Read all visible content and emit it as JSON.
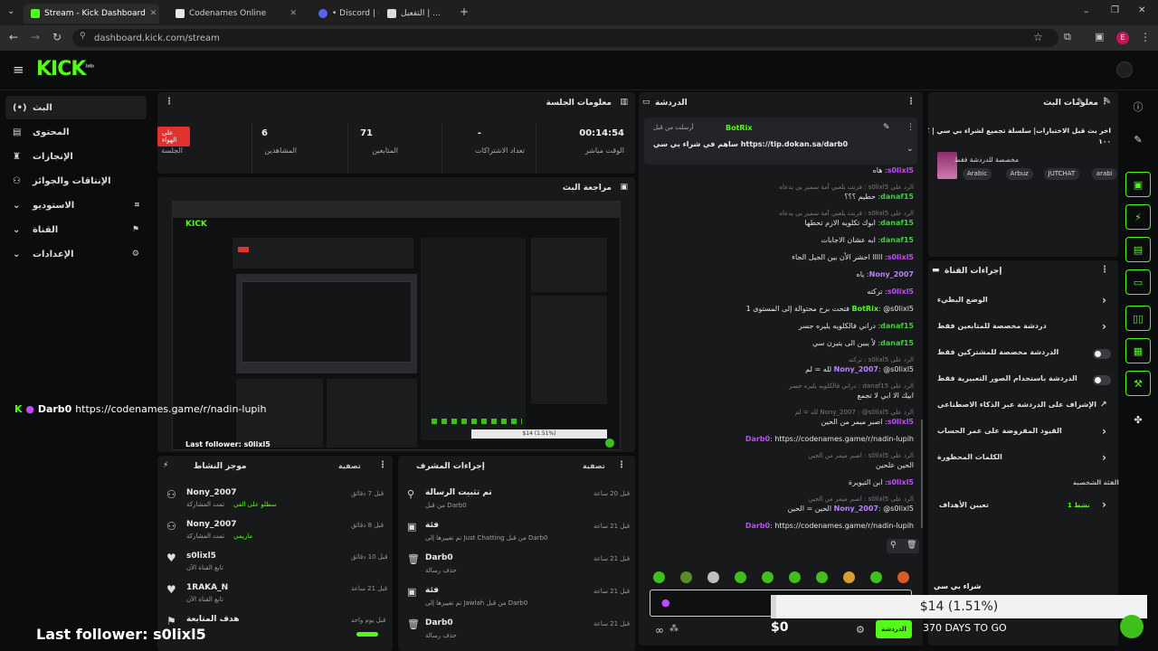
{
  "browser": {
    "tabs": [
      {
        "label": "Stream - Kick Dashboard",
        "active": true,
        "color": "#53fc18"
      },
      {
        "label": "Codenames Online",
        "active": false,
        "color": "#e8e8e8"
      },
      {
        "label": "• Discord | #",
        "active": false,
        "color": "#5865f2"
      },
      {
        "label": "التفعيل | ...",
        "active": false,
        "color": "#dddddd"
      }
    ],
    "url": "dashboard.kick.com/stream",
    "profile_initial": "E"
  },
  "app": {
    "logo": "KICK",
    "logo_sup": "beta"
  },
  "sidebar": {
    "items": [
      {
        "label": "البث",
        "icon": "live-icon",
        "glyph": "(•)",
        "active": true
      },
      {
        "label": "المحتوى",
        "icon": "content-icon",
        "glyph": "▤"
      },
      {
        "label": "الإنجازات",
        "icon": "trophy-icon",
        "glyph": "♜"
      },
      {
        "label": "الإنتاقات والجوائز",
        "icon": "gift-icon",
        "glyph": "⚇"
      },
      {
        "label": "الاستوديو",
        "icon": "studio-icon",
        "glyph": "⌄",
        "end": "⌗"
      },
      {
        "label": "القناة",
        "icon": "channel-icon",
        "glyph": "⌄",
        "end": "⚑"
      },
      {
        "label": "الإعدادات",
        "icon": "settings-icon",
        "glyph": "⌄",
        "end": "⚙"
      }
    ]
  },
  "session": {
    "title": "معلومات الجلسة",
    "live_badge": "على الهواء",
    "stats": [
      {
        "value": "00:14:54",
        "label": "الوقت مباشر"
      },
      {
        "value": "-",
        "label": "تعداد الاشتراكات"
      },
      {
        "value": "71",
        "label": "المتابعين"
      },
      {
        "value": "6",
        "label": "المشاهدين"
      },
      {
        "value": "",
        "label": "الجلسة"
      }
    ]
  },
  "preview": {
    "title": "مراجعة البث",
    "mini_title": "Darb0 : https://codenames.game/r/nadin-lupih",
    "mini_follower": "Last follower: s0lixl5",
    "mini_goal": "$14 (1.51%)"
  },
  "activity": {
    "title": "موجز النشاط",
    "filter_label": "تصفية",
    "items": [
      {
        "name": "Nony_2007",
        "sub": "تمت المشاركة",
        "sub2": "سطلو على الفي",
        "time": "قبل 7 دقائق",
        "icon": "sub-icon"
      },
      {
        "name": "Nony_2007",
        "sub": "تمت المشاركة",
        "sub2": "ماريمي",
        "time": "قبل 8 دقائق",
        "icon": "sub-icon"
      },
      {
        "name": "s0lixl5",
        "sub": "تابع القناة الآن",
        "sub2": "",
        "time": "قبل 10 دقائق",
        "icon": "heart-icon"
      },
      {
        "name": "1RAKA_N",
        "sub": "تابع القناة الآن",
        "sub2": "",
        "time": "قبل 21 ساعة",
        "icon": "heart-icon"
      },
      {
        "name": "هدف المتابعة",
        "sub": "",
        "sub2": "",
        "time": "قبل يوم واحد",
        "icon": "goal-icon"
      }
    ]
  },
  "mod_actions": {
    "title": "إجراءات المشرف",
    "filter_label": "تصفية",
    "items": [
      {
        "name": "تم تثبيت الرسالة",
        "sub": "من قبل Darb0",
        "time": "قبل 20 ساعة",
        "icon": "pin-icon"
      },
      {
        "name": "فئة",
        "sub": "تم تغييرها إلى Just Chatting من قبل Darb0",
        "time": "قبل 21 ساعة",
        "icon": "category-icon"
      },
      {
        "name": "Darb0",
        "sub": "حذف رسالة",
        "time": "قبل 21 ساعة",
        "icon": "trash-icon"
      },
      {
        "name": "فئة",
        "sub": "تم تغييرها إلى Jawlah من قبل Darb0",
        "time": "قبل 21 ساعة",
        "icon": "category-icon"
      },
      {
        "name": "Darb0",
        "sub": "حذف رسالة",
        "time": "قبل 21 ساعة",
        "icon": "trash-icon"
      }
    ]
  },
  "chat": {
    "title": "الدردشة",
    "pinned_by": "أرسلت من قبل",
    "pinned_user": "BotRix",
    "pinned_text": "ساهم في شراء بي سي https://tip.dokan.sa/darb0",
    "messages": [
      {
        "reply": "",
        "user": "s0lixl5",
        "color": "#c04bff",
        "text": "هاه"
      },
      {
        "reply": "الرد على s0lixl5 : فرنت يلعبي آمة سمير بي يدعاه",
        "user": "",
        "color": "",
        "text": ""
      },
      {
        "reply": "",
        "user": "danaf15",
        "color": "#3fd13a",
        "text": "حطيم ؟؟؟"
      },
      {
        "reply": "الرد على s0lixl5 : فرنت يلعبي آمة سمير بي يدعاه",
        "user": "",
        "color": "",
        "text": ""
      },
      {
        "reply": "",
        "user": "danaf15",
        "color": "#3fd13a",
        "text": "ابوك تكلويه الازم تحطها"
      },
      {
        "reply": "",
        "user": "danaf15",
        "color": "#3fd13a",
        "text": "ابه عشان الاجابات"
      },
      {
        "reply": "",
        "user": "s0lixl5",
        "color": "#c04bff",
        "text": "ااااا احشر الأن بين الجيل الجاء"
      },
      {
        "reply": "",
        "user": "Nony_2007",
        "color": "#b784ff",
        "text": "ياه"
      },
      {
        "reply": "",
        "user": "s0lixl5",
        "color": "#c04bff",
        "text": "تركته"
      },
      {
        "reply": "",
        "user": "BotRix",
        "color": "#53fc18",
        "text": "@s0lixl5 فتحت برخ محتوالة إلى المستوى 1"
      },
      {
        "reply": "",
        "user": "danaf15",
        "color": "#3fd13a",
        "text": "دراني فالكلويه يليره جسر"
      },
      {
        "reply": "",
        "user": "danaf15",
        "color": "#3fd13a",
        "text": "لأ يبين الى يتيرن سي"
      },
      {
        "reply": "الرد على s0lixl5 : تركته",
        "user": "",
        "color": "",
        "text": ""
      },
      {
        "reply": "",
        "user": "Nony_2007",
        "color": "#b784ff",
        "text": "@s0lixl5 لله = لم"
      },
      {
        "reply": "الرد على danaf15 : دراني فالكلويه يليره جسر",
        "user": "",
        "color": "",
        "text": ""
      },
      {
        "reply": "",
        "user": "",
        "color": "",
        "text": "ابيك الا ابي لا تجمع"
      },
      {
        "reply": "الرد على Nony_2007 : @s0lixl5 لله = لم",
        "user": "",
        "color": "",
        "text": ""
      },
      {
        "reply": "",
        "user": "s0lixl5",
        "color": "#c04bff",
        "text": "اصبر ميمر من الحين"
      },
      {
        "reply": "",
        "user": "Darb0",
        "color": "#c04bff",
        "text": "https://codenames.game/r/nadin-lupih"
      },
      {
        "reply": "الرد على s0lixl5 : اصبر ميمر من الحين",
        "user": "",
        "color": "",
        "text": ""
      },
      {
        "reply": "",
        "user": "",
        "color": "",
        "text": "الحين علحين"
      },
      {
        "reply": "",
        "user": "s0lixl5",
        "color": "#c04bff",
        "text": "ابن التيويرة"
      },
      {
        "reply": "الرد على s0lixl5 : اصبر ميمر من الحين",
        "user": "",
        "color": "",
        "text": ""
      },
      {
        "reply": "",
        "user": "Nony_2007",
        "color": "#b784ff",
        "text": "@s0lixl5 الحين = الحين"
      },
      {
        "reply": "",
        "user": "Darb0",
        "color": "#c04bff",
        "text": "https://codenames.game/r/nadin-lupih"
      }
    ],
    "send_label": "الدردشة"
  },
  "stream_info": {
    "title": "معلومات البث",
    "stream_title": "اخر بث قبل الاختبارات| سلسلة تجميع لشراء بي سي | ؟",
    "stream_title2": "١٠٠",
    "category": "مخصصة للدردشة فقط",
    "tags": [
      "Arabic",
      "Arbuz",
      "JUTCHAT",
      "arabi"
    ]
  },
  "channel_actions": {
    "title": "إجراءات القناة",
    "items": [
      {
        "label": "الوضع البطيء",
        "control": "chevron"
      },
      {
        "label": "دردشة مخصصة للمتابعين فقط",
        "control": "chevron"
      },
      {
        "label": "الدردشة مخصصة للمشتركين فقط",
        "control": "toggle"
      },
      {
        "label": "الدردشة باستخدام الصور التعبيرية فقط",
        "control": "toggle"
      },
      {
        "label": "الإشراف على الدردشة عبر الذكاء الاصطناعي",
        "control": "external"
      },
      {
        "label": "القيود المفروضة على عمر الحساب",
        "control": "chevron"
      },
      {
        "label": "الكلمات المحظورة",
        "control": "chevron"
      }
    ],
    "section_label": "الفئة الشخصية",
    "goals_label": "تعيين الأهداف",
    "goals_status": "نشط 1"
  },
  "goal_overlay": {
    "title": "شراء بي سي",
    "amount": "$14 (1.51%)",
    "left": "$0",
    "days": "370 DAYS TO GO",
    "progress": 0.0151
  },
  "stream_overlay": {
    "link_user": "Darb0",
    "link_text": "https://codenames.game/r/nadin-lupih",
    "last_follower": "Last follower: s0lixl5"
  }
}
